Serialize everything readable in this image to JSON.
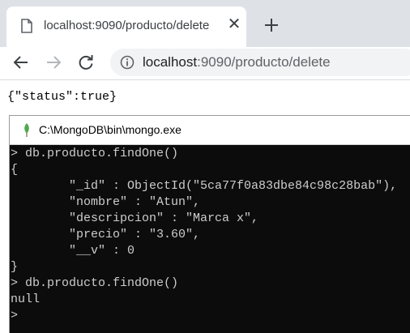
{
  "browser": {
    "tab": {
      "title": "localhost:9090/producto/delete",
      "favicon": "page-icon",
      "close_glyph": "✕"
    },
    "new_tab_icon": "plus-icon",
    "toolbar": {
      "back_icon": "arrow-left-icon",
      "forward_icon": "arrow-right-icon",
      "reload_icon": "reload-icon",
      "site_info_icon": "info-icon",
      "url_host": "localhost",
      "url_rest": ":9090/producto/delete"
    }
  },
  "page": {
    "json_text": "{\"status\":true}"
  },
  "console": {
    "title": "C:\\MongoDB\\bin\\mongo.exe",
    "icon": "mongodb-leaf-icon",
    "lines": [
      "> db.producto.findOne()",
      "{",
      "        \"_id\" : ObjectId(\"5ca77f0a83dbe84c98c28bab\"),",
      "        \"nombre\" : \"Atun\",",
      "        \"descripcion\" : \"Marca x\",",
      "        \"precio\" : \"3.60\",",
      "        \"__v\" : 0",
      "}",
      "> db.producto.findOne()",
      "null",
      ">"
    ]
  },
  "colors": {
    "tabstrip": "#dee1e6",
    "console_bg": "#0c0c0c",
    "console_text": "#cccccc",
    "mongo_leaf": "#4fa94d"
  }
}
